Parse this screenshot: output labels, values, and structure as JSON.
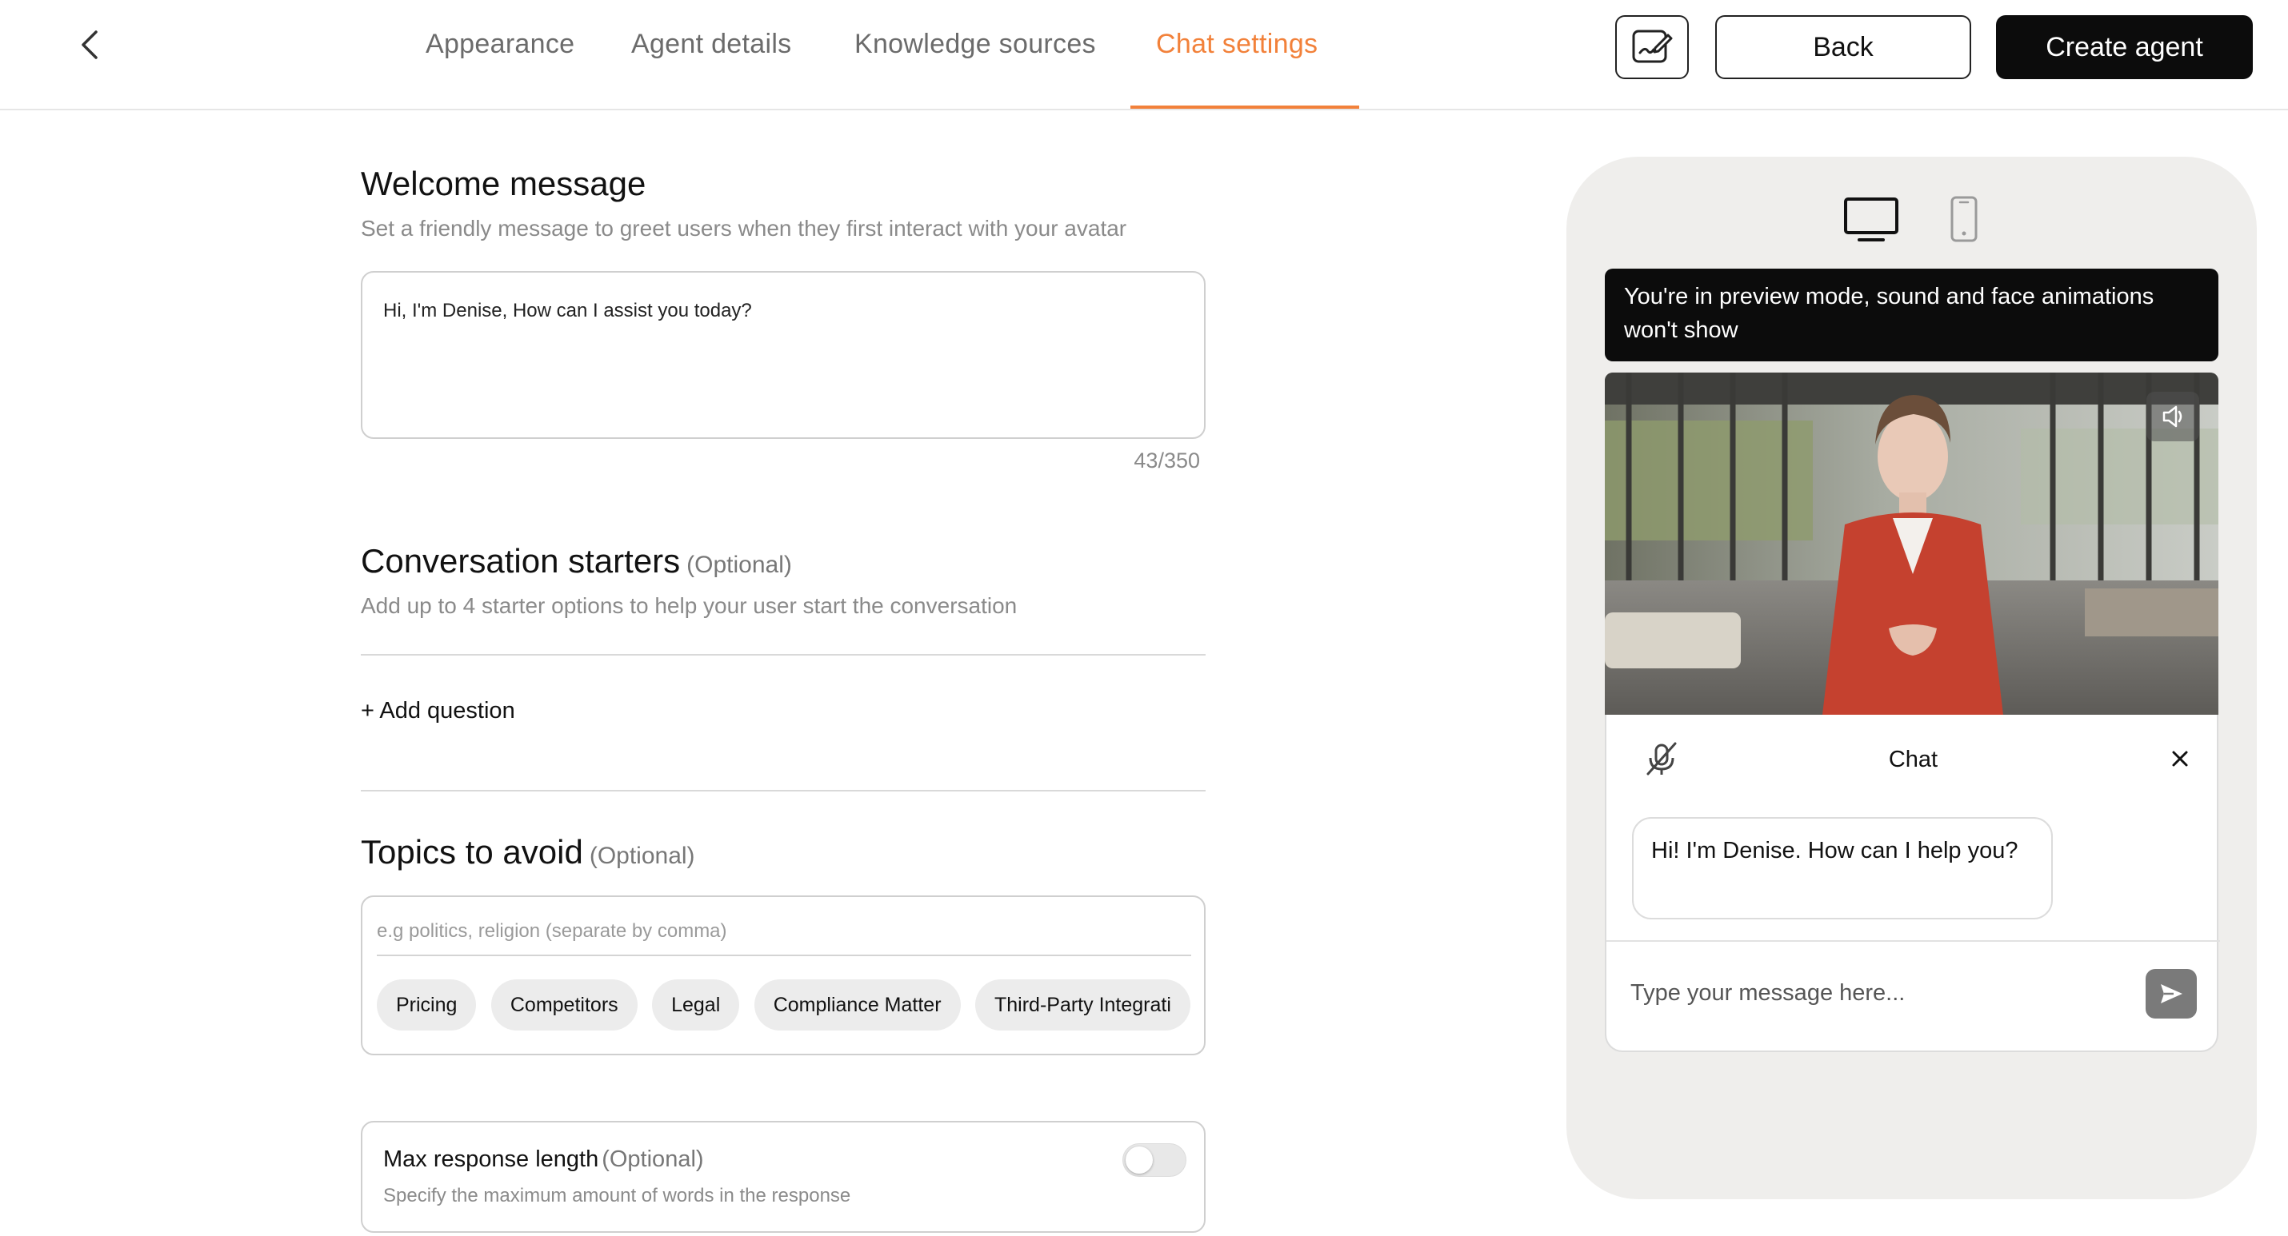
{
  "header": {
    "tabs": [
      {
        "label": "Appearance"
      },
      {
        "label": "Agent details"
      },
      {
        "label": "Knowledge sources"
      },
      {
        "label": "Chat settings",
        "active": true
      }
    ],
    "back_label": "Back",
    "create_label": "Create agent",
    "accent_color": "#f2813a",
    "icons": {
      "back": "chevron-left-icon",
      "script_editor": "script-edit-icon"
    }
  },
  "welcome": {
    "title": "Welcome message",
    "description": "Set a friendly message to greet users when they first interact with your avatar",
    "message": "Hi, I'm Denise, How can I assist you today?",
    "char_count": "43/350"
  },
  "starters": {
    "title": "Conversation starters",
    "optional": "(Optional)",
    "description": "Add up to 4 starter options to help your user start the conversation",
    "add_label": "+ Add question"
  },
  "topics": {
    "title": "Topics to avoid",
    "optional": "(Optional)",
    "placeholder": "e.g politics, religion (separate by comma)",
    "chips": [
      "Pricing",
      "Competitors",
      "Legal",
      "Compliance Matter",
      "Third-Party Integrati"
    ]
  },
  "max_response": {
    "title": "Max response length",
    "optional": "(Optional)",
    "description": "Specify the maximum amount of words in the response",
    "enabled": false
  },
  "preview": {
    "banner": "You're in preview mode, sound and face animations won't show",
    "chat_title": "Chat",
    "greeting": "Hi! I'm Denise. How can I help you?",
    "input_placeholder": "Type your message here...",
    "icons": {
      "desktop": "desktop-icon",
      "mobile": "mobile-icon",
      "mute": "speaker-icon",
      "mic": "mic-off-icon",
      "close": "close-icon",
      "send": "send-icon"
    }
  }
}
